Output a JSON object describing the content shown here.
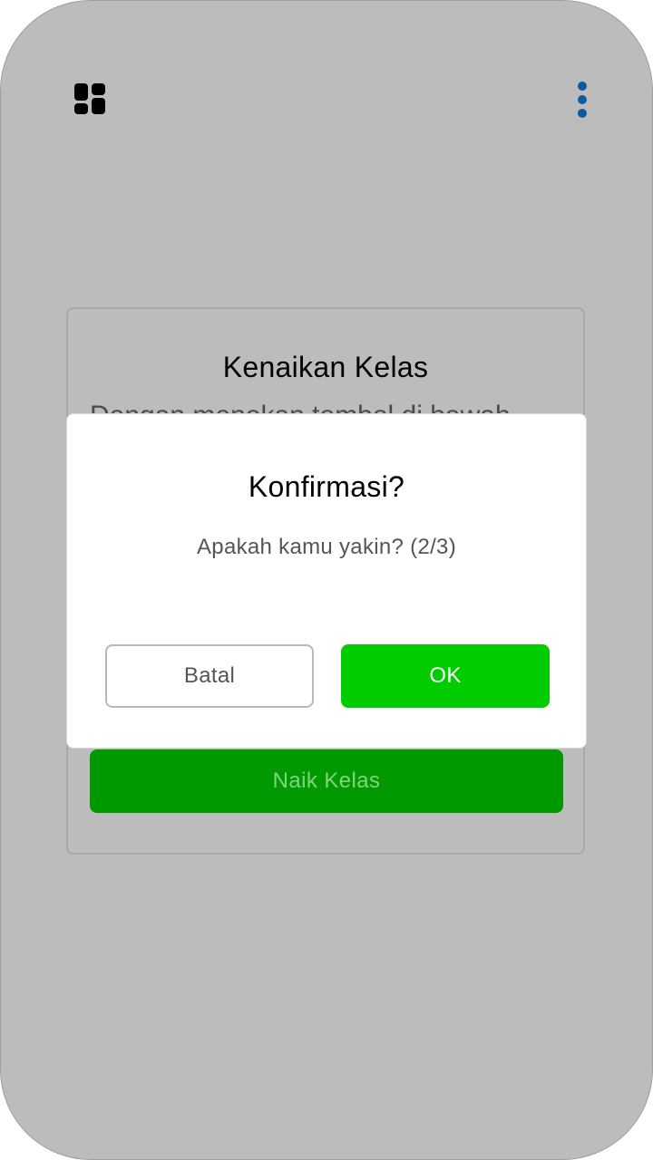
{
  "app": {
    "menu_icon": "dashboard-icon",
    "more_icon": "more-vertical-icon",
    "accent_color": "#0a5aa0"
  },
  "card": {
    "title": "Kenaikan Kelas",
    "description": "Dengan menekan tombol di bawah",
    "action_label": "Naik Kelas"
  },
  "dialog": {
    "title": "Konfirmasi?",
    "message": "Apakah kamu yakin? (2/3)",
    "cancel_label": "Batal",
    "ok_label": "OK",
    "ok_color": "#00cc00"
  }
}
